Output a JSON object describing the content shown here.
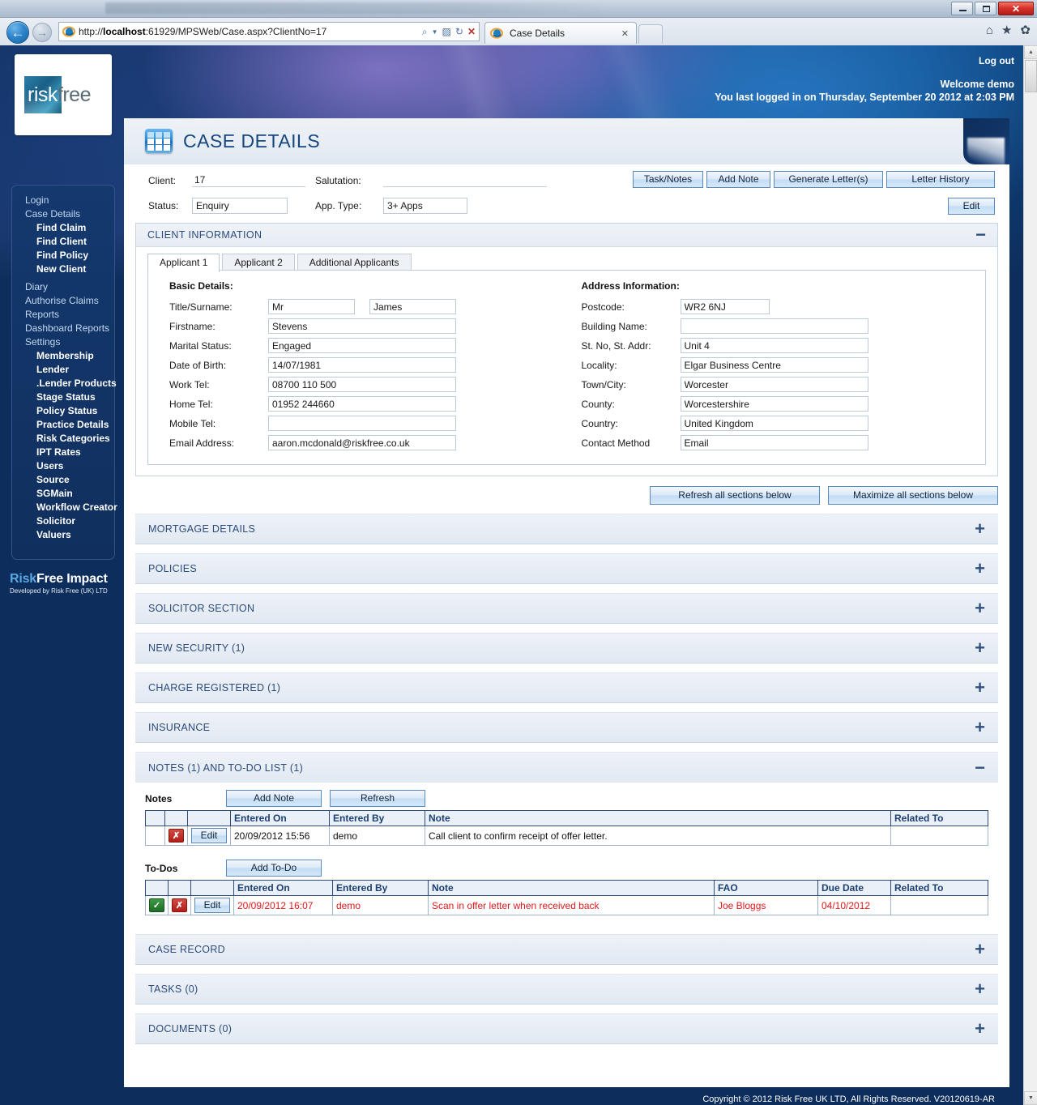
{
  "browser": {
    "url_prefix": "http://",
    "url_host": "localhost",
    "url_rest": ":61929/MPSWeb/Case.aspx?ClientNo=17",
    "tab_title": "Case Details",
    "tab_close": "✕",
    "back_arrow": "←",
    "forward_arrow": "→",
    "search_icon": "⌕",
    "compat_icon": "▨",
    "refresh_icon": "↻",
    "stop_icon": "✕",
    "home_icon": "⌂",
    "favorites_icon": "★",
    "tools_icon": "✿",
    "minimize_label": "",
    "maximize_label": "",
    "close_label": "✕"
  },
  "header": {
    "logo_risk": "risk",
    "logo_free": "free",
    "logout": "Log out",
    "welcome": "Welcome demo",
    "last_login": "You last logged in on Thursday, September 20 2012 at 2:03 PM"
  },
  "sidebar": {
    "items": [
      {
        "label": "Login",
        "level": "top"
      },
      {
        "label": "Case Details",
        "level": "top"
      },
      {
        "label": "Find Claim",
        "level": "sub"
      },
      {
        "label": "Find Client",
        "level": "sub"
      },
      {
        "label": "Find Policy",
        "level": "sub"
      },
      {
        "label": "New Client",
        "level": "sub"
      },
      {
        "label": "Diary",
        "level": "top"
      },
      {
        "label": "Authorise Claims",
        "level": "top"
      },
      {
        "label": "Reports",
        "level": "top"
      },
      {
        "label": "Dashboard Reports",
        "level": "top"
      },
      {
        "label": "Settings",
        "level": "top"
      },
      {
        "label": "Membership",
        "level": "sub"
      },
      {
        "label": "Lender",
        "level": "sub"
      },
      {
        "label": ".Lender Products",
        "level": "sub"
      },
      {
        "label": "Stage Status",
        "level": "sub"
      },
      {
        "label": "Policy Status",
        "level": "sub"
      },
      {
        "label": "Practice Details",
        "level": "sub"
      },
      {
        "label": "Risk Categories",
        "level": "sub"
      },
      {
        "label": "IPT Rates",
        "level": "sub"
      },
      {
        "label": "Users",
        "level": "sub"
      },
      {
        "label": "Source",
        "level": "sub"
      },
      {
        "label": "SGMain",
        "level": "sub"
      },
      {
        "label": "Workflow Creator",
        "level": "sub"
      },
      {
        "label": "Solicitor",
        "level": "sub"
      },
      {
        "label": "Valuers",
        "level": "sub"
      }
    ],
    "brand_risk": "Risk",
    "brand_free": "Free Impact",
    "brand_sub": "Developed by Risk Free (UK) LTD"
  },
  "page": {
    "title": "CASE DETAILS",
    "icon": "table-grid-icon"
  },
  "topform": {
    "client_label": "Client:",
    "client_value": "17",
    "salutation_label": "Salutation:",
    "salutation_value": "",
    "status_label": "Status:",
    "status_value": "Enquiry",
    "apptype_label": "App. Type:",
    "apptype_value": "3+ Apps",
    "buttons": {
      "task_notes": "Task/Notes",
      "add_note": "Add Note",
      "generate_letters": "Generate Letter(s)",
      "letter_history": "Letter History",
      "edit": "Edit"
    }
  },
  "client_information": {
    "title": "CLIENT INFORMATION",
    "toggle": "−",
    "tabs": [
      {
        "label": "Applicant 1",
        "active": true
      },
      {
        "label": "Applicant 2",
        "active": false
      },
      {
        "label": "Additional Applicants",
        "active": false
      }
    ],
    "basic_details": {
      "heading": "Basic Details:",
      "fields": [
        {
          "label": "Title/Surname:",
          "value": "Mr",
          "value2": "James"
        },
        {
          "label": "Firstname:",
          "value": "Stevens"
        },
        {
          "label": "Marital Status:",
          "value": "Engaged"
        },
        {
          "label": "Date of Birth:",
          "value": "14/07/1981"
        },
        {
          "label": "Work Tel:",
          "value": "08700 110 500"
        },
        {
          "label": "Home Tel:",
          "value": "01952 244660"
        },
        {
          "label": "Mobile Tel:",
          "value": ""
        },
        {
          "label": "Email Address:",
          "value": "aaron.mcdonald@riskfree.co.uk"
        }
      ]
    },
    "address_information": {
      "heading": "Address Information:",
      "fields": [
        {
          "label": "Postcode:",
          "value": "WR2 6NJ"
        },
        {
          "label": "Building Name:",
          "value": ""
        },
        {
          "label": "St. No, St. Addr:",
          "value": "Unit 4"
        },
        {
          "label": "Locality:",
          "value": "Elgar Business Centre"
        },
        {
          "label": "Town/City:",
          "value": "Worcester"
        },
        {
          "label": "County:",
          "value": "Worcestershire"
        },
        {
          "label": "Country:",
          "value": "United Kingdom"
        },
        {
          "label": "Contact Method",
          "value": "Email"
        }
      ]
    }
  },
  "section_actions": {
    "refresh_all": "Refresh all sections below",
    "maximize_all": "Maximize all sections below"
  },
  "sections_upper": [
    {
      "title": "MORTGAGE DETAILS",
      "toggle": "+"
    },
    {
      "title": "POLICIES",
      "toggle": "+"
    },
    {
      "title": "SOLICITOR SECTION",
      "toggle": "+"
    },
    {
      "title": "NEW SECURITY (1)",
      "toggle": "+"
    },
    {
      "title": "CHARGE REGISTERED (1)",
      "toggle": "+"
    },
    {
      "title": "INSURANCE",
      "toggle": "+"
    }
  ],
  "notes_section": {
    "title": "NOTES (1) AND TO-DO LIST (1)",
    "toggle": "−",
    "notes": {
      "caption": "Notes",
      "add_button": "Add Note",
      "refresh_button": "Refresh",
      "columns": [
        "",
        "",
        "",
        "Entered On",
        "Entered By",
        "Note",
        "Related To"
      ],
      "rows": [
        {
          "tick": "",
          "delete": "✗",
          "edit": "Edit",
          "entered_on": "20/09/2012 15:56",
          "entered_by": "demo",
          "note": "Call client to confirm receipt of offer letter.",
          "related_to": ""
        }
      ]
    },
    "todos": {
      "caption": "To-Dos",
      "add_button": "Add To-Do",
      "columns": [
        "",
        "",
        "",
        "Entered On",
        "Entered By",
        "Note",
        "FAO",
        "Due Date",
        "Related To"
      ],
      "rows": [
        {
          "tick": "✓",
          "delete": "✗",
          "edit": "Edit",
          "entered_on": "20/09/2012 16:07",
          "entered_by": "demo",
          "note": "Scan in offer letter when received back",
          "fao": "Joe Bloggs",
          "due_date": "04/10/2012",
          "related_to": ""
        }
      ]
    }
  },
  "sections_lower": [
    {
      "title": "CASE RECORD",
      "toggle": "+"
    },
    {
      "title": "TASKS (0)",
      "toggle": "+"
    },
    {
      "title": "DOCUMENTS (0)",
      "toggle": "+"
    }
  ],
  "footer": {
    "copyright": "Copyright © 2012 Risk Free UK LTD, All Rights Reserved. V20120619-AR"
  }
}
